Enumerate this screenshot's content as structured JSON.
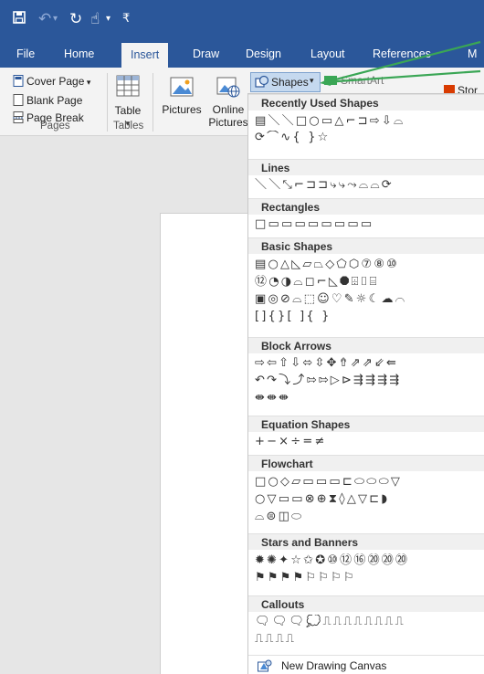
{
  "qat": {
    "icons": [
      "save-icon",
      "undo-icon",
      "redo-icon",
      "touch-mode-icon",
      "customize-icon"
    ]
  },
  "tabs": [
    {
      "label": "File"
    },
    {
      "label": "Home"
    },
    {
      "label": "Insert",
      "active": true
    },
    {
      "label": "Draw"
    },
    {
      "label": "Design"
    },
    {
      "label": "Layout"
    },
    {
      "label": "References"
    },
    {
      "label": "M"
    }
  ],
  "ribbon": {
    "pages_group": {
      "cover_page": "Cover Page",
      "blank_page": "Blank Page",
      "page_break": "Page Break",
      "label": "Pages"
    },
    "tables_group": {
      "table": "Table",
      "label": "Tables"
    },
    "pictures": "Pictures",
    "online_pictures_line1": "Online",
    "online_pictures_line2": "Pictures",
    "shapes": "Shapes",
    "smartart": "SmartArt",
    "store": "Stor"
  },
  "colors": {
    "ribbon_blue": "#2b579a",
    "accent_green": "#3aa655",
    "store_red": "#d83b01"
  },
  "gallery": {
    "sections": [
      {
        "title": "Recently Used Shapes",
        "rows": [
          "▤＼＼□○▭△⌐⊐⇨⇩⌓",
          "⟳⌒∿{ }☆"
        ]
      },
      {
        "title": "Lines",
        "rows": [
          "＼＼⤡⌐⊐⊐⤷⤷⤳⌓⌓⟳"
        ]
      },
      {
        "title": "Rectangles",
        "rows": [
          "□▭▭▭▭▭▭▭▭"
        ]
      },
      {
        "title": "Basic Shapes",
        "rows": [
          "▤○△◺▱⏢◇⬠⬡⑦⑧⑩",
          "⑫◔◑⌓◻⌐◺⯃⌹⌷⌸",
          "▣◎⊘⌓⬚☺♡✎☼☾☁⌒",
          "[]{}[ ]{ }"
        ]
      },
      {
        "title": "Block Arrows",
        "rows": [
          "⇨⇦⇧⇩⬄⇳✥⇮⇗⇗⇙⇚",
          "↶↷⤵⤴⇰⇰▷⊳⇶⇶⇶⇶",
          "⇼⇼⇼"
        ]
      },
      {
        "title": "Equation Shapes",
        "rows": [
          "+−×÷=≠"
        ]
      },
      {
        "title": "Flowchart",
        "rows": [
          "□○◇▱▭▭▭⊏⬭⬭⬭▽",
          "○▽▭▭⊗⊕⧗◊△▽⊏◗",
          "⌓⊜◫⬭"
        ]
      },
      {
        "title": "Stars and Banners",
        "rows": [
          "✹✺✦☆✩✪⑩⑫⑯⑳⑳⑳",
          "⚑⚑⚑⚑⚐⚐⚐⚐"
        ]
      },
      {
        "title": "Callouts",
        "rows": [
          "🗨🗨🗨💭⎍⎍⎍⎍⎍⎍⎍⎍",
          "⎍⎍⎍⎍"
        ]
      }
    ],
    "new_drawing_canvas": "New Drawing Canvas"
  }
}
